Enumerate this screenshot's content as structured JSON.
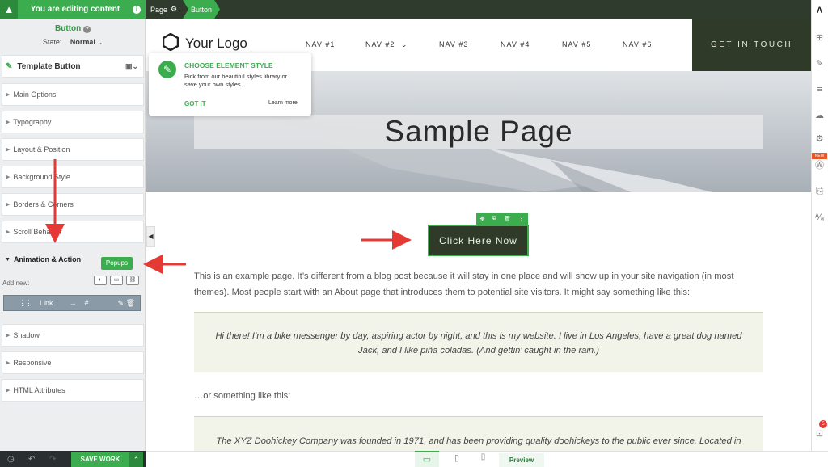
{
  "editor": {
    "banner": "You are editing content",
    "element_name": "Button",
    "state_label": "State:",
    "state_value": "Normal",
    "template_label": "Template Button",
    "sections": [
      "Main Options",
      "Typography",
      "Layout & Position",
      "Background Style",
      "Borders & Corners",
      "Scroll Behavior"
    ],
    "open_section": "Animation & Action",
    "popups_badge": "Popups",
    "add_new_label": "Add new:",
    "link_item": {
      "label": "Link",
      "arrow": "→",
      "target": "#"
    },
    "sections_after": [
      "Shadow",
      "Responsive",
      "HTML Attributes"
    ],
    "save_label": "SAVE WORK"
  },
  "breadcrumb": {
    "page": "Page",
    "current": "Button"
  },
  "site": {
    "logo_text": "Your Logo",
    "nav": [
      "NAV #1",
      "NAV #2",
      "NAV #3",
      "NAV #4",
      "NAV #5",
      "NAV #6"
    ],
    "cta": "GET IN TOUCH",
    "hero_title": "Sample Page",
    "button_label": "Click Here Now",
    "paragraph1": "This is an example page. It’s different from a blog post because it will stay in one place and will show up in your site navigation (in most themes). Most people start with an About page that introduces them to potential site visitors. It might say something like this:",
    "quote1": "Hi there! I’m a bike messenger by day, aspiring actor by night, and this is my website. I live in Los Angeles, have a great dog named Jack, and I like piña coladas. (And gettin’ caught in the rain.)",
    "paragraph2": "…or something like this:",
    "quote2": "The XYZ Doohickey Company was founded in 1971, and has been providing quality doohickeys to the public ever since. Located in"
  },
  "tooltip": {
    "title": "CHOOSE ELEMENT STYLE",
    "body": "Pick from our beautiful styles library or save your own styles.",
    "got_it": "GOT IT",
    "learn_more": "Learn more"
  },
  "bottom": {
    "preview_label": "Preview"
  },
  "sidebar_right": {
    "new_badge": "NEW",
    "notif_count": "5"
  },
  "colors": {
    "accent_green": "#3cad4f",
    "dark_olive": "#2f3a28",
    "arrow_red": "#e53935"
  }
}
